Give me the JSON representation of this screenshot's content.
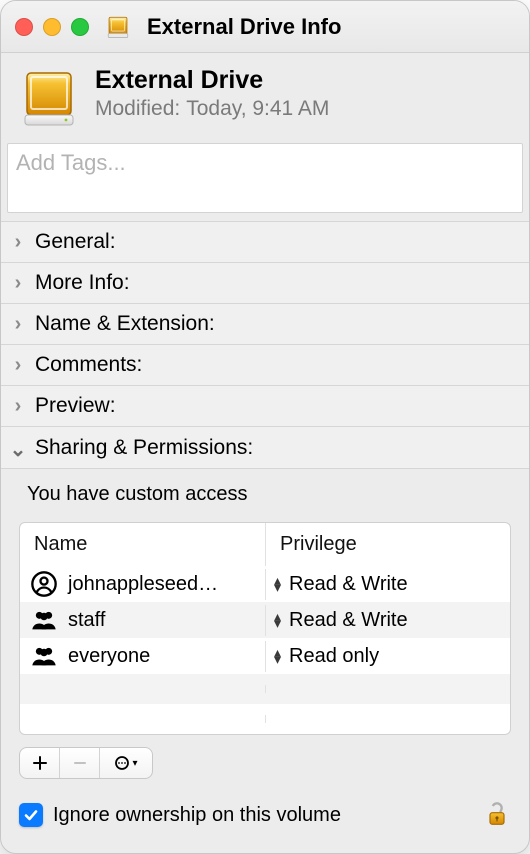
{
  "window": {
    "title": "External Drive Info"
  },
  "header": {
    "name": "External Drive",
    "modified_label": "Modified:",
    "modified_value": "Today, 9:41 AM"
  },
  "tags": {
    "placeholder": "Add Tags..."
  },
  "sections": {
    "general": "General:",
    "more_info": "More Info:",
    "name_extension": "Name & Extension:",
    "comments": "Comments:",
    "preview": "Preview:",
    "sharing": "Sharing & Permissions:"
  },
  "sharing": {
    "access_text": "You have custom access",
    "columns": {
      "name": "Name",
      "privilege": "Privilege"
    },
    "rows": [
      {
        "icon": "person",
        "name": "johnappleseed…",
        "privilege": "Read & Write"
      },
      {
        "icon": "group",
        "name": "staff",
        "privilege": "Read & Write"
      },
      {
        "icon": "group",
        "name": "everyone",
        "privilege": "Read only"
      }
    ],
    "checkbox_label": "Ignore ownership on this volume",
    "checkbox_checked": true,
    "buttons": {
      "add": "+",
      "remove": "—",
      "more": "⊙"
    }
  }
}
